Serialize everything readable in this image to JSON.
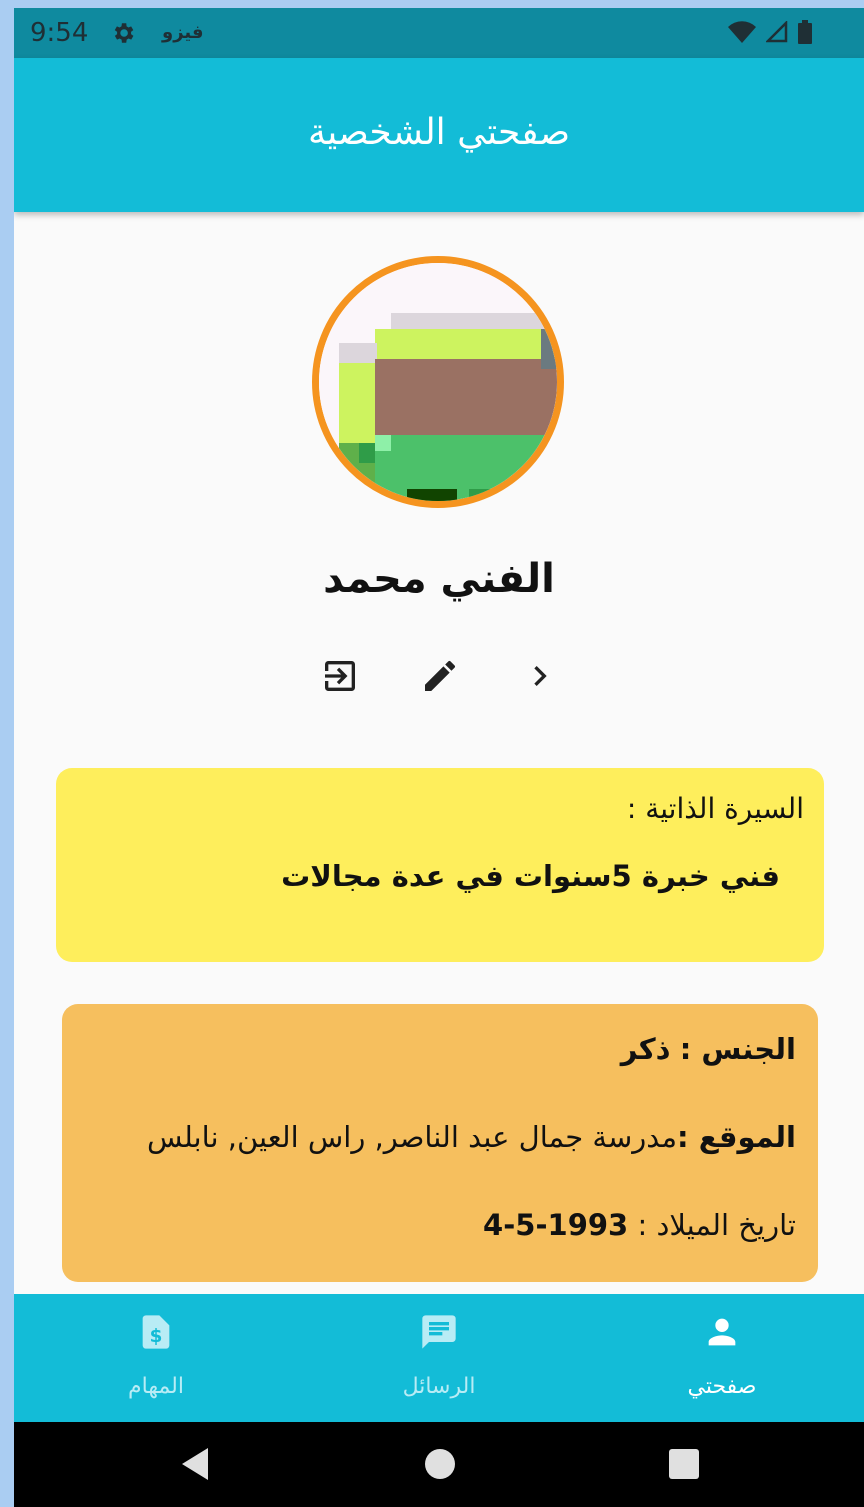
{
  "status_bar": {
    "time": "9:54",
    "app_icon_text": "فيزو"
  },
  "app_bar": {
    "title": "صفحتي الشخصية"
  },
  "profile": {
    "name": "الفني محمد"
  },
  "bio": {
    "label": "السيرة الذاتية :",
    "text": "فني خبرة 5سنوات في عدة مجالات"
  },
  "info": {
    "gender_label": "الجنس :",
    "gender_value": "ذكر",
    "location_label": "الموقع :",
    "location_value": "مدرسة جمال عبد الناصر,  راس العين,  نابلس",
    "birth_label": "تاريخ الميلاد :",
    "birth_value": "1993-5-4"
  },
  "bottom_nav": {
    "items": [
      {
        "label": "المهام",
        "icon": "invoice-dollar-icon"
      },
      {
        "label": "الرسائل",
        "icon": "message-icon"
      },
      {
        "label": "صفحتي",
        "icon": "person-icon"
      }
    ]
  },
  "colors": {
    "status_bar": "#0f8a9f",
    "app_bar": "#13bcd7",
    "avatar_border": "#f5941f",
    "bio_card": "#feee5c",
    "info_card": "#f6bf5e",
    "nav_inactive": "#b8ecf5",
    "nav_active": "#ffffff"
  }
}
